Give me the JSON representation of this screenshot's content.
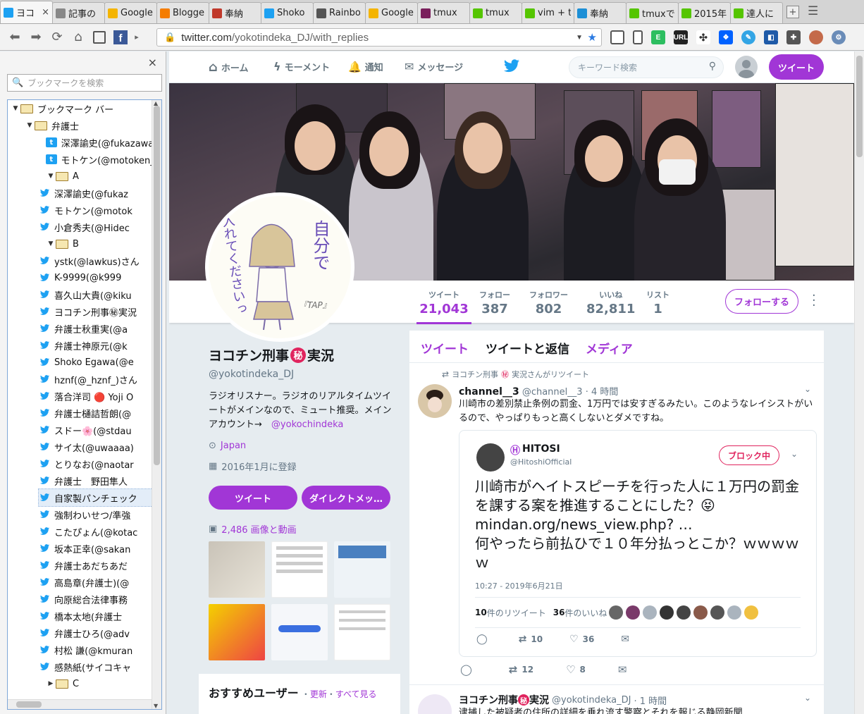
{
  "tabs": [
    {
      "label": "ヨコ",
      "favicon": "twitter-icon",
      "color": "#1da1f2",
      "active": true
    },
    {
      "label": "記事の",
      "favicon": "info-icon",
      "color": "#888"
    },
    {
      "label": "Google",
      "favicon": "google-icon",
      "color": "#f4b400"
    },
    {
      "label": "Blogge",
      "favicon": "blogger-icon",
      "color": "#f57d00"
    },
    {
      "label": "奉納",
      "favicon": "site-icon",
      "color": "#c0392b"
    },
    {
      "label": "Shoko",
      "favicon": "twitter-icon",
      "color": "#1da1f2"
    },
    {
      "label": "Rainbo",
      "favicon": "doc-icon",
      "color": "#555"
    },
    {
      "label": "Google",
      "favicon": "google-icon",
      "color": "#f4b400"
    },
    {
      "label": "tmux",
      "favicon": "video-icon",
      "color": "#7a1f5c"
    },
    {
      "label": "tmux",
      "favicon": "qiita-icon",
      "color": "#55c500"
    },
    {
      "label": "vim + t",
      "favicon": "qiita-icon",
      "color": "#55c500"
    },
    {
      "label": "奉納",
      "favicon": "hatena-icon",
      "color": "#1d8fd6"
    },
    {
      "label": "tmuxで",
      "favicon": "qiita-icon",
      "color": "#55c500"
    },
    {
      "label": "2015年",
      "favicon": "qiita-icon",
      "color": "#55c500"
    },
    {
      "label": "達人に",
      "favicon": "qiita-icon",
      "color": "#55c500"
    }
  ],
  "close_tab": "×",
  "url": {
    "host": "twitter.com",
    "path": "/yokotindeka_DJ/with_replies"
  },
  "sidebar": {
    "close": "×",
    "search_placeholder": "ブックマークを検索",
    "items": [
      {
        "label": "ブックマーク バー",
        "type": "folder",
        "level": 0,
        "open": true
      },
      {
        "label": "弁護士",
        "type": "folder",
        "level": 1,
        "open": true
      },
      {
        "label": "深澤諭史(@fukazawa",
        "type": "link",
        "level": 2,
        "icon": "t-icon"
      },
      {
        "label": "モトケン(@motoken_",
        "type": "link",
        "level": 2,
        "icon": "t-icon"
      },
      {
        "label": "A",
        "type": "folder",
        "level": 2,
        "open": true
      },
      {
        "label": "深澤諭史(@fukaz",
        "type": "link",
        "level": 3
      },
      {
        "label": "モトケン(@motok",
        "type": "link",
        "level": 3
      },
      {
        "label": "小倉秀夫(@Hidec",
        "type": "link",
        "level": 3
      },
      {
        "label": "B",
        "type": "folder",
        "level": 2,
        "open": true
      },
      {
        "label": "ystk(@lawkus)さん",
        "type": "link",
        "level": 3
      },
      {
        "label": "K-9999(@k999",
        "type": "link",
        "level": 3
      },
      {
        "label": "喜久山大貴(@kiku",
        "type": "link",
        "level": 3
      },
      {
        "label": "ヨコチン刑事㊙実況",
        "type": "link",
        "level": 3
      },
      {
        "label": "弁護士秋重実(@a",
        "type": "link",
        "level": 3
      },
      {
        "label": "弁護士神原元(@k",
        "type": "link",
        "level": 3
      },
      {
        "label": "Shoko Egawa(@e",
        "type": "link",
        "level": 3
      },
      {
        "label": "hznf(@_hznf_)さん",
        "type": "link",
        "level": 3
      },
      {
        "label": "落合洋司 🔴 Yoji O",
        "type": "link",
        "level": 3
      },
      {
        "label": "弁護士樋詰哲朗(@",
        "type": "link",
        "level": 3
      },
      {
        "label": "スドー🌸(@stdau",
        "type": "link",
        "level": 3
      },
      {
        "label": "サイ太(@uwaaaa)",
        "type": "link",
        "level": 3
      },
      {
        "label": "とりなお(@naotar",
        "type": "link",
        "level": 3
      },
      {
        "label": "弁護士　野田隼人",
        "type": "link",
        "level": 3
      },
      {
        "label": "自家製パンチェック",
        "type": "link",
        "level": 3,
        "selected": true
      },
      {
        "label": "強制わいせつ/準強",
        "type": "link",
        "level": 3
      },
      {
        "label": "こたぴょん(@kotac",
        "type": "link",
        "level": 3
      },
      {
        "label": "坂本正幸(@sakan",
        "type": "link",
        "level": 3
      },
      {
        "label": "弁護士あだちあだ",
        "type": "link",
        "level": 3
      },
      {
        "label": "高島章(弁護士)(@",
        "type": "link",
        "level": 3
      },
      {
        "label": "向原総合法律事務",
        "type": "link",
        "level": 3
      },
      {
        "label": "橋本太地(弁護士",
        "type": "link",
        "level": 3
      },
      {
        "label": "弁護士ひろ(@adv",
        "type": "link",
        "level": 3
      },
      {
        "label": "村松 謙(@kmuran",
        "type": "link",
        "level": 3
      },
      {
        "label": "感熱紙(サイコキャ",
        "type": "link",
        "level": 3
      },
      {
        "label": "C",
        "type": "folder",
        "level": 2,
        "open": false
      }
    ]
  },
  "twitter": {
    "nav": {
      "home": "ホーム",
      "moments": "モーメント",
      "notifications": "通知",
      "messages": "メッセージ"
    },
    "search_placeholder": "キーワード検索",
    "tweet_button": "ツイート",
    "stats": [
      {
        "label": "ツイート",
        "value": "21,043",
        "active": true
      },
      {
        "label": "フォロー",
        "value": "387"
      },
      {
        "label": "フォロワー",
        "value": "802"
      },
      {
        "label": "いいね",
        "value": "82,811"
      },
      {
        "label": "リスト",
        "value": "1"
      }
    ],
    "follow_button": "フォローする",
    "avatar_text": {
      "line1": "自分で",
      "line2": "入れてくださいっ",
      "tag": "『TAP』"
    },
    "profile": {
      "name_pre": "ヨコチン刑事",
      "name_badge": "秘",
      "name_post": "実況",
      "handle": "@yokotindeka_DJ",
      "bio": "ラジオリスナー。ラジオのリアルタイムツイートがメインなので、ミュート推奨。メインアカウント→",
      "bio_link": "@yokochindeka",
      "location": "Japan",
      "joined": "2016年1月に登録",
      "btn_tweet": "ツイート",
      "btn_dm": "ダイレクトメッ…",
      "media_count": "2,486 画像と動画"
    },
    "recommend": {
      "title": "おすすめユーザー",
      "refresh": "更新",
      "all": "すべて見る",
      "sep": "・"
    },
    "timeline_tabs": {
      "tweets": "ツイート",
      "replies": "ツイートと返信",
      "media": "メディア"
    },
    "tweet1": {
      "retweeted_by_pre": "ヨコチン刑事",
      "retweeted_by_badge": "㊙",
      "retweeted_by_post": "実況さんがリツイート",
      "name": "channel__3",
      "handle": "@channel__3",
      "time": "· 4 時間",
      "text": "川崎市の差別禁止条例の罰金、1万円では安すぎるみたい。このようなレイシストがいるので、やっぱりもっと高くしないとダメですね。",
      "quoted": {
        "name": "HITOSI",
        "handle": "@HitoshiOfficial",
        "block": "ブロック中",
        "text1": "川崎市がヘイトスピーチを行った人に１万円の罰金を課する案を推進することにした？😝",
        "link": "mindan.org/news_view.php? …",
        "text2": "何やったら前払ひで１０年分払っとこか？ｗｗｗｗｗ",
        "date": "10:27 - 2019年6月21日",
        "rt_count": "10",
        "rt_label": "件のリツイート",
        "like_count": "36",
        "like_label": "件のいいね",
        "reply_n": "",
        "retweet_n": "10",
        "like_n": "36"
      },
      "reply_n": "",
      "retweet_n": "12",
      "like_n": "8"
    },
    "tweet2": {
      "name_pre": "ヨコチン刑事",
      "name_badge": "秘",
      "name_post": "実況",
      "handle": "@yokotindeka_DJ",
      "time": "· 1 時間",
      "text": "逮捕した被疑者の住所の詳細を垂れ流す警察とそれを報じる静岡新聞"
    }
  },
  "colors": {
    "accent": "#a136d6",
    "twitter_blue": "#1da1f2",
    "link": "#a136d6"
  }
}
